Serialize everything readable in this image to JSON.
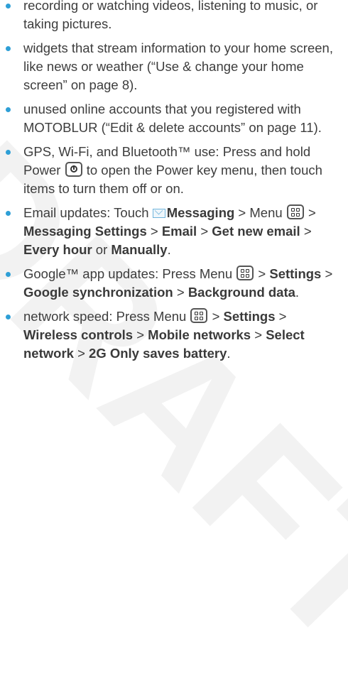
{
  "watermark": "DRAFT",
  "bullet_color": "#2e9fd6",
  "items": [
    {
      "parts": [
        {
          "t": "recording or watching videos, listening to music, or taking pictures."
        }
      ]
    },
    {
      "parts": [
        {
          "t": "widgets that stream information to your home screen, like news or weather (“Use & change your home screen” on page 8)."
        }
      ]
    },
    {
      "parts": [
        {
          "t": "unused online accounts that you registered with MOTOBLUR (“Edit & delete accounts” on page 11)."
        }
      ]
    },
    {
      "parts": [
        {
          "t": "GPS, Wi-Fi, and Bluetooth™ use: Press and hold Power "
        },
        {
          "icon": "power-key-icon"
        },
        {
          "t": " to open the Power key menu, then touch items to turn them off or on."
        }
      ]
    },
    {
      "parts": [
        {
          "t": "Email updates: Touch "
        },
        {
          "icon": "messaging-envelope-icon"
        },
        {
          "t": "Messaging",
          "b": true
        },
        {
          "t": " > Menu "
        },
        {
          "icon": "menu-key-icon"
        },
        {
          "t": " > "
        },
        {
          "t": "Messaging Settings",
          "b": true
        },
        {
          "t": " > "
        },
        {
          "t": "Email",
          "b": true
        },
        {
          "t": " > "
        },
        {
          "t": "Get new email",
          "b": true
        },
        {
          "t": " > "
        },
        {
          "t": "Every hour",
          "b": true
        },
        {
          "t": " or "
        },
        {
          "t": "Manually",
          "b": true
        },
        {
          "t": "."
        }
      ]
    },
    {
      "parts": [
        {
          "t": "Google™ app updates: Press Menu "
        },
        {
          "icon": "menu-key-icon"
        },
        {
          "t": " > "
        },
        {
          "t": "Settings",
          "b": true
        },
        {
          "t": " > "
        },
        {
          "t": "Google synchronization",
          "b": true
        },
        {
          "t": " > "
        },
        {
          "t": "Background data",
          "b": true
        },
        {
          "t": "."
        }
      ]
    },
    {
      "parts": [
        {
          "t": "network speed: Press Menu "
        },
        {
          "icon": "menu-key-icon"
        },
        {
          "t": " > "
        },
        {
          "t": "Settings",
          "b": true
        },
        {
          "t": " > "
        },
        {
          "t": "Wireless controls",
          "b": true
        },
        {
          "t": " > "
        },
        {
          "t": "Mobile networks",
          "b": true
        },
        {
          "t": " > "
        },
        {
          "t": "Select network",
          "b": true
        },
        {
          "t": " > "
        },
        {
          "t": "2G Only saves battery",
          "b": true
        },
        {
          "t": "."
        }
      ]
    }
  ]
}
